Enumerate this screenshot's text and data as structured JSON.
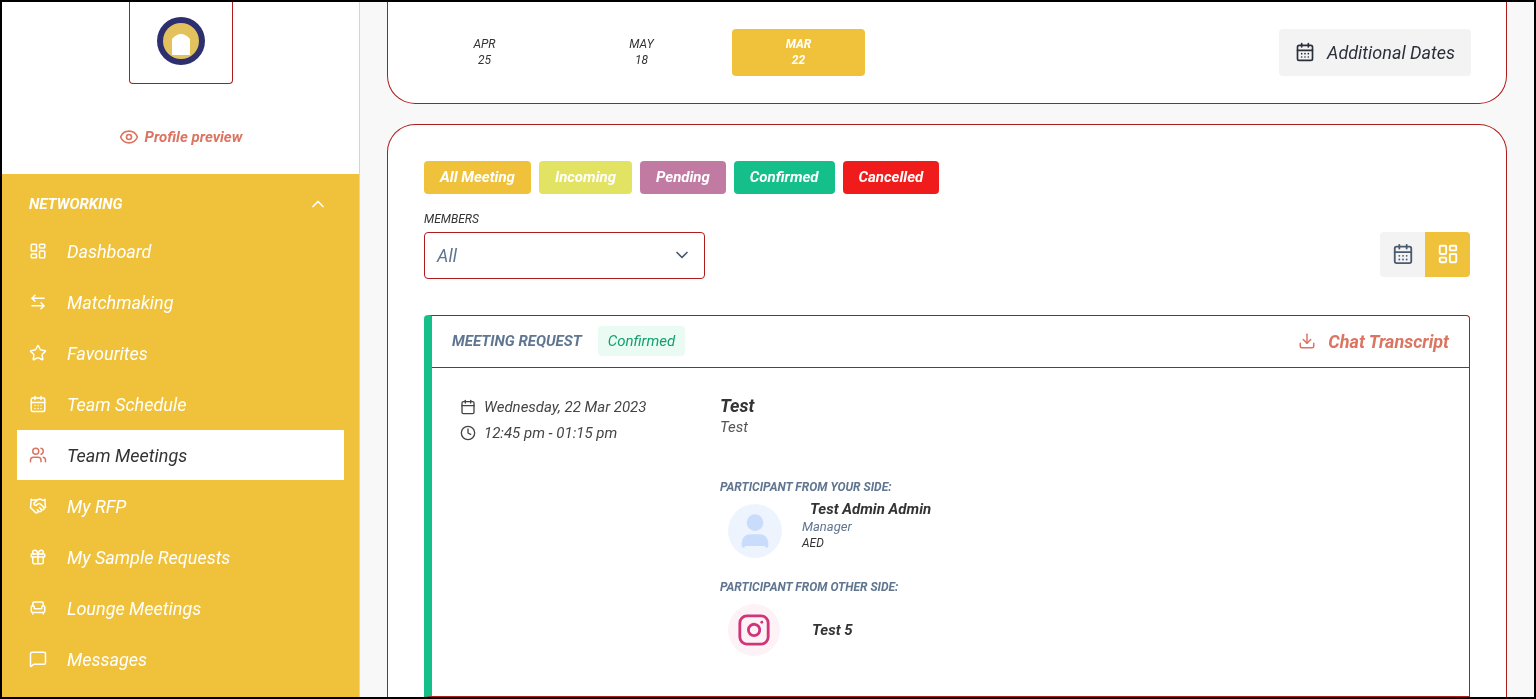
{
  "sidebar": {
    "profile_link": "Profile preview",
    "section": {
      "title": "NETWORKING",
      "expanded": true
    },
    "items": [
      {
        "label": "Dashboard",
        "selected": false
      },
      {
        "label": "Matchmaking",
        "selected": false
      },
      {
        "label": "Favourites",
        "selected": false
      },
      {
        "label": "Team Schedule",
        "selected": false
      },
      {
        "label": "Team Meetings",
        "selected": true
      },
      {
        "label": "My RFP",
        "selected": false
      },
      {
        "label": "My Sample Requests",
        "selected": false
      },
      {
        "label": "Lounge Meetings",
        "selected": false
      },
      {
        "label": "Messages",
        "selected": false
      }
    ]
  },
  "dates": [
    {
      "month": "APR",
      "day": "25",
      "selected": false
    },
    {
      "month": "MAY",
      "day": "18",
      "selected": false
    },
    {
      "month": "MAR",
      "day": "22",
      "selected": true
    }
  ],
  "additional_dates_button": "Additional Dates",
  "filters": [
    {
      "label": "All Meeting",
      "color": "#f0c23b"
    },
    {
      "label": "Incoming",
      "color": "#e2e362"
    },
    {
      "label": "Pending",
      "color": "#c17ba3"
    },
    {
      "label": "Confirmed",
      "color": "#14bf8a"
    },
    {
      "label": "Cancelled",
      "color": "#f01c1c"
    }
  ],
  "members": {
    "label": "MEMBERS",
    "value": "All"
  },
  "view_toggle": [
    {
      "selected": false
    },
    {
      "selected": true
    }
  ],
  "meeting": {
    "type": "MEETING REQUEST",
    "status": "Confirmed",
    "chat_transcript": "Chat Transcript",
    "date": "Wednesday, 22 Mar 2023",
    "time": "12:45 pm - 01:15 pm",
    "title": "Test",
    "subtitle": "Test",
    "your_side": {
      "heading": "PARTICIPANT FROM YOUR SIDE:",
      "name": "Test Admin Admin",
      "role": "Manager",
      "company": "AED"
    },
    "other_side": {
      "heading": "PARTICIPANT FROM OTHER SIDE:",
      "name": "Test 5"
    }
  }
}
